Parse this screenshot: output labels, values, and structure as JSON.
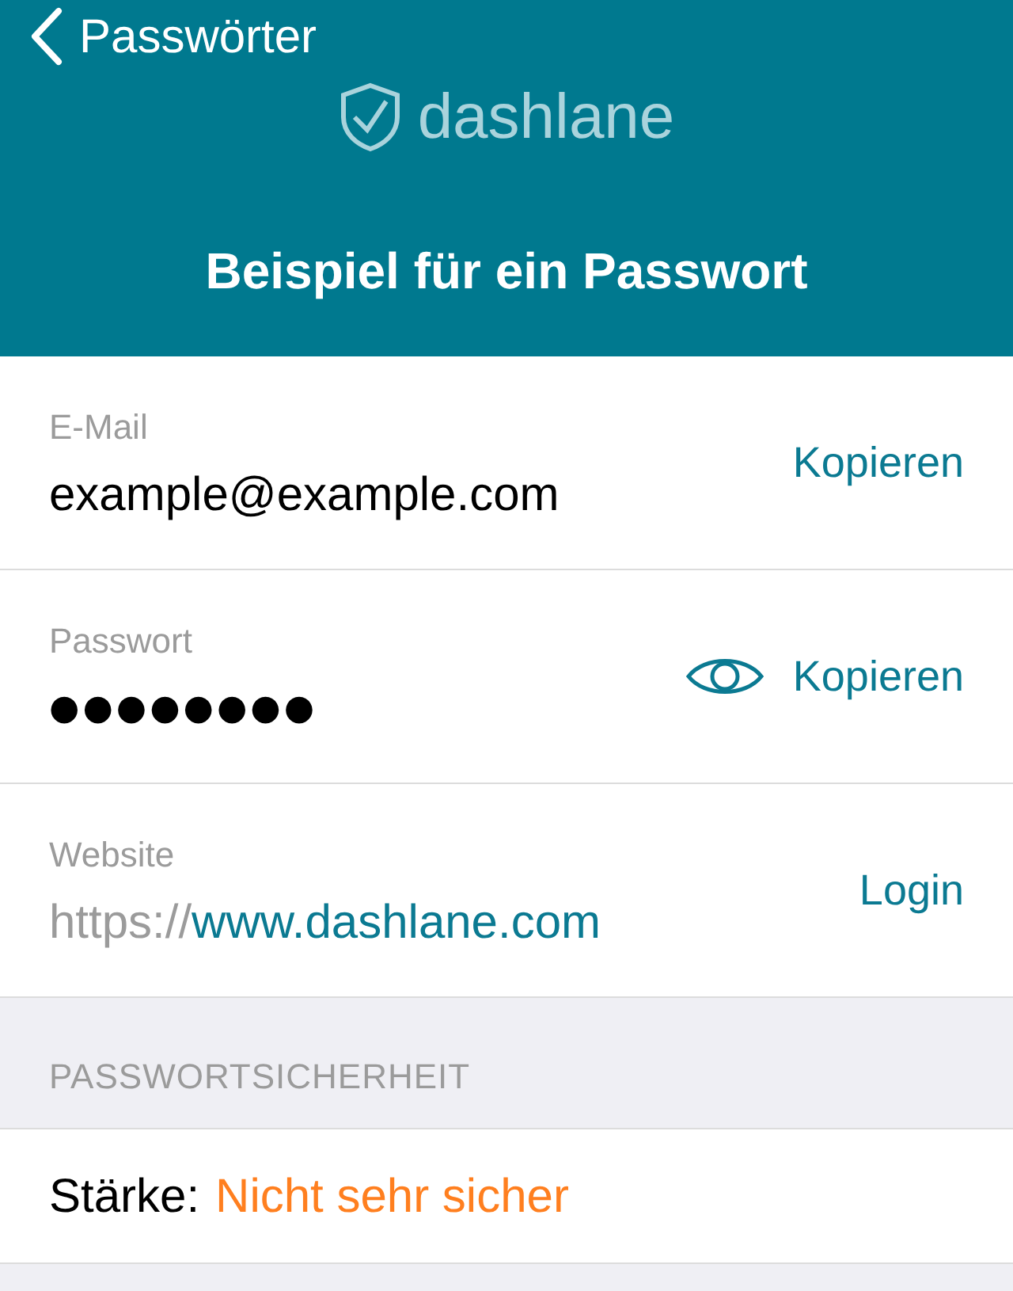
{
  "nav": {
    "back_label": "Passwörter"
  },
  "logo": {
    "text": "dashlane"
  },
  "title": "Beispiel für ein Passwort",
  "fields": [
    {
      "kind": "text",
      "label": "E-Mail",
      "value": "example@example.com",
      "action": "Kopieren"
    },
    {
      "kind": "secret",
      "label": "Passwort",
      "value": "●●●●●●●●",
      "action": "Kopieren"
    },
    {
      "kind": "url",
      "label": "Website",
      "scheme": "https://",
      "host": "www.dashlane.com",
      "action": "Login"
    }
  ],
  "section": {
    "header": "PASSWORTSICHERHEIT",
    "strength_label": "Stärke:",
    "strength_value": "Nicht sehr sicher"
  }
}
